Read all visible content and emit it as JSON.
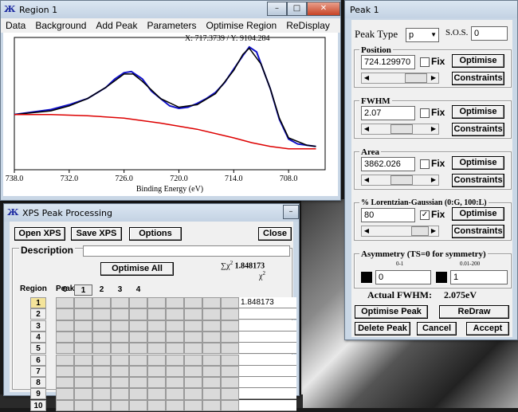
{
  "region_window": {
    "title": "Region 1",
    "menu": [
      "Data",
      "Background",
      "Add Peak",
      "Parameters",
      "Optimise Region",
      "ReDisplay"
    ],
    "coord_readout": "X: 717.3739 / Y: 9104.284",
    "xlabel": "Binding Energy (eV)",
    "xticks": [
      "738.0",
      "732.0",
      "726.0",
      "720.0",
      "714.0",
      "708.0"
    ]
  },
  "chart_data": {
    "type": "line",
    "xlabel": "Binding Energy (eV)",
    "xlim": [
      738.0,
      704.0
    ],
    "xticks": [
      738.0,
      732.0,
      726.0,
      720.0,
      714.0,
      708.0
    ],
    "series": [
      {
        "role": "raw_data",
        "color": "#1010c8",
        "x": [
          738,
          736,
          734,
          732,
          730,
          728,
          727,
          726,
          725.2,
          724,
          723,
          722,
          721,
          720,
          719,
          718,
          717,
          716,
          715,
          714,
          713,
          712.3,
          711.5,
          711,
          710,
          709,
          708,
          707,
          706,
          705
        ],
        "y": [
          0.45,
          0.47,
          0.49,
          0.53,
          0.58,
          0.67,
          0.74,
          0.79,
          0.8,
          0.74,
          0.64,
          0.58,
          0.52,
          0.5,
          0.51,
          0.54,
          0.58,
          0.63,
          0.71,
          0.82,
          0.93,
          1.0,
          0.96,
          0.86,
          0.66,
          0.41,
          0.25,
          0.21,
          0.2,
          0.19
        ]
      },
      {
        "role": "envelope",
        "color": "#000000",
        "x": [
          738,
          734,
          732,
          730,
          728,
          726,
          725,
          724,
          722,
          720,
          718,
          716,
          714,
          713,
          712.3,
          711,
          710,
          709,
          708,
          706,
          705
        ],
        "y": [
          0.45,
          0.48,
          0.52,
          0.58,
          0.67,
          0.78,
          0.78,
          0.72,
          0.58,
          0.51,
          0.53,
          0.62,
          0.81,
          0.94,
          0.99,
          0.86,
          0.66,
          0.42,
          0.26,
          0.2,
          0.19
        ]
      },
      {
        "role": "background",
        "color": "#dd0000",
        "x": [
          738,
          734,
          730,
          726,
          722,
          718,
          714,
          712,
          710,
          708,
          706,
          705
        ],
        "y": [
          0.45,
          0.45,
          0.44,
          0.42,
          0.38,
          0.33,
          0.26,
          0.22,
          0.19,
          0.17,
          0.17,
          0.17
        ]
      }
    ]
  },
  "xps_window": {
    "title": "XPS Peak Processing",
    "buttons": {
      "open": "Open XPS",
      "save": "Save XPS",
      "options": "Options",
      "close": "Close",
      "optimise_all": "Optimise All"
    },
    "description_label": "Description",
    "chi_sum_label": "∑χ",
    "chi_sum_value": "1.848173",
    "chi_col_label": "χ",
    "region_label": "Region",
    "peaks_label": "Peaks",
    "peak_cols": [
      "0",
      "1",
      "2",
      "3",
      "4",
      "",
      "",
      "",
      "",
      ""
    ],
    "regions": [
      "1",
      "2",
      "3",
      "4",
      "5",
      "6",
      "7",
      "8",
      "9",
      "10"
    ],
    "chi_values": [
      "1.848173",
      "",
      "",
      "",
      "",
      "",
      "",
      "",
      "",
      ""
    ]
  },
  "peak_window": {
    "title": "Peak 1",
    "peak_type_label": "Peak Type",
    "peak_type_value": "p",
    "sos_label": "S.O.S.",
    "sos_value": "0",
    "position": {
      "label": "Position",
      "value": "724.129970",
      "fix": "Fix",
      "fixed": false,
      "optimise": "Optimise",
      "constraints": "Constraints"
    },
    "fwhm": {
      "label": "FWHM",
      "value": "2.07",
      "fix": "Fix",
      "fixed": false,
      "optimise": "Optimise",
      "constraints": "Constraints"
    },
    "area": {
      "label": "Area",
      "value": "3862.026",
      "fix": "Fix",
      "fixed": false,
      "optimise": "Optimise",
      "constraints": "Constraints"
    },
    "lg": {
      "label": "% Lorentzian-Gaussian (0:G, 100:L)",
      "value": "80",
      "fix": "Fix",
      "fixed": true,
      "optimise": "Optimise",
      "constraints": "Constraints"
    },
    "asym": {
      "label": "Asymmetry (TS=0 for symmetry)",
      "range_left": "0-1",
      "range_right": "0.01-200",
      "value_left": "0",
      "value_right": "1"
    },
    "actual_fwhm_label": "Actual FWHM:",
    "actual_fwhm_value": "2.075eV",
    "buttons": {
      "optimise_peak": "Optimise Peak",
      "redraw": "ReDraw",
      "delete_peak": "Delete Peak",
      "cancel": "Cancel",
      "accept": "Accept"
    }
  }
}
